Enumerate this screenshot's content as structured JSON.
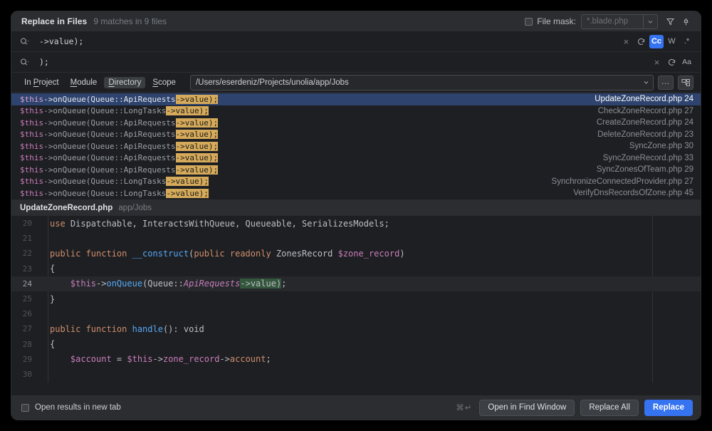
{
  "header": {
    "title": "Replace in Files",
    "match_summary": "9 matches in 9 files",
    "file_mask_label": "File mask:",
    "file_mask_value": "*.blade.php",
    "filter_icon": "filter-icon",
    "pin_icon": "pin-icon"
  },
  "search": {
    "query": "->value);",
    "options": {
      "clear": "×",
      "history": "history-icon",
      "match_case": "Cc",
      "whole_words": "W",
      "regex": ".*"
    }
  },
  "replace": {
    "value": ");",
    "options": {
      "clear": "×",
      "history": "history-icon",
      "preserve_case": "Aa"
    }
  },
  "scope": {
    "tabs": [
      {
        "label": "In Project",
        "selected": false
      },
      {
        "label": "Module",
        "selected": false
      },
      {
        "label": "Directory",
        "selected": true
      },
      {
        "label": "Scope",
        "selected": false
      }
    ],
    "path": "/Users/eserdeniz/Projects/unolia/app/Jobs",
    "more_button": "…",
    "module_button": "module-icon"
  },
  "results": [
    {
      "prefix": "$this",
      "mid": "->onQueue(Queue::ApiRequests",
      "hit": "->value);",
      "file": "UpdateZoneRecord.php",
      "line": "24",
      "selected": true
    },
    {
      "prefix": "$this",
      "mid": "->onQueue(Queue::LongTasks",
      "hit": "->value);",
      "file": "CheckZoneRecord.php",
      "line": "27",
      "selected": false
    },
    {
      "prefix": "$this",
      "mid": "->onQueue(Queue::ApiRequests",
      "hit": "->value);",
      "file": "CreateZoneRecord.php",
      "line": "24",
      "selected": false
    },
    {
      "prefix": "$this",
      "mid": "->onQueue(Queue::ApiRequests",
      "hit": "->value);",
      "file": "DeleteZoneRecord.php",
      "line": "23",
      "selected": false
    },
    {
      "prefix": "$this",
      "mid": "->onQueue(Queue::ApiRequests",
      "hit": "->value);",
      "file": "SyncZone.php",
      "line": "30",
      "selected": false
    },
    {
      "prefix": "$this",
      "mid": "->onQueue(Queue::ApiRequests",
      "hit": "->value);",
      "file": "SyncZoneRecord.php",
      "line": "33",
      "selected": false
    },
    {
      "prefix": "$this",
      "mid": "->onQueue(Queue::ApiRequests",
      "hit": "->value);",
      "file": "SyncZonesOfTeam.php",
      "line": "29",
      "selected": false
    },
    {
      "prefix": "$this",
      "mid": "->onQueue(Queue::LongTasks",
      "hit": "->value);",
      "file": "SynchronizeConnectedProvider.php",
      "line": "27",
      "selected": false
    },
    {
      "prefix": "$this",
      "mid": "->onQueue(Queue::LongTasks",
      "hit": "->value);",
      "file": "VerifyDnsRecordsOfZone.php",
      "line": "45",
      "selected": false
    }
  ],
  "preview": {
    "file_name": "UpdateZoneRecord.php",
    "file_path": "app/Jobs",
    "lines": [
      {
        "num": "20",
        "highlighted": false
      },
      {
        "num": "21",
        "highlighted": false
      },
      {
        "num": "22",
        "highlighted": false
      },
      {
        "num": "23",
        "highlighted": false
      },
      {
        "num": "24",
        "highlighted": true
      },
      {
        "num": "25",
        "highlighted": false
      },
      {
        "num": "26",
        "highlighted": false
      },
      {
        "num": "27",
        "highlighted": false
      },
      {
        "num": "28",
        "highlighted": false
      },
      {
        "num": "29",
        "highlighted": false
      },
      {
        "num": "30",
        "highlighted": false
      }
    ],
    "code_text": {
      "l20": "use Dispatchable, InteractsWithQueue, Queueable, SerializesModels;",
      "l22": "public function __construct(public readonly ZonesRecord $zone_record)",
      "l23": "{",
      "l24": "$this->onQueue(Queue::ApiRequests->value);",
      "l25": "}",
      "l27": "public function handle(): void",
      "l28": "{",
      "l29": "$account = $this->zone_record->account;"
    }
  },
  "footer": {
    "open_new_tab_label": "Open results in new tab",
    "shortcut": "⌘↵",
    "open_find_window": "Open in Find Window",
    "replace_all": "Replace All",
    "replace": "Replace"
  },
  "colors": {
    "accent": "#3573f0",
    "selection": "#2e436e",
    "match_highlight": "#d5aa5a",
    "code_match_highlight": "#33563c",
    "panel_bg": "#1e1f22",
    "chrome_bg": "#2b2d30"
  }
}
